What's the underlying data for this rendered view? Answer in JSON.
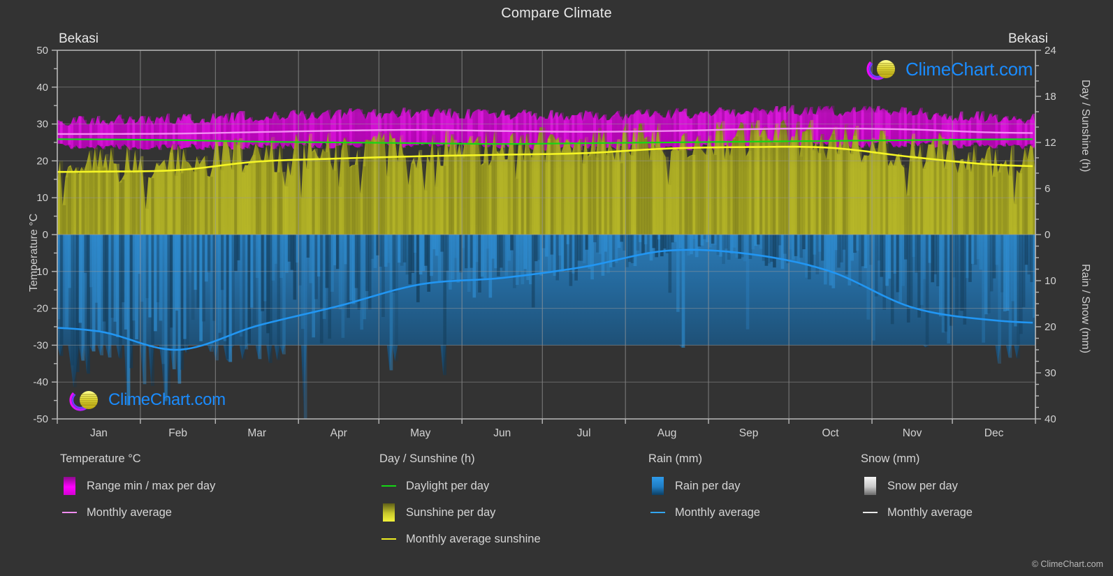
{
  "header": {
    "title": "Compare Climate",
    "location_left": "Bekasi",
    "location_right": "Bekasi"
  },
  "axes": {
    "left_title": "Temperature °C",
    "right_top_title": "Day / Sunshine (h)",
    "right_bottom_title": "Rain / Snow (mm)",
    "left_ticks": [
      "50",
      "40",
      "30",
      "20",
      "10",
      "0",
      "-10",
      "-20",
      "-30",
      "-40",
      "-50"
    ],
    "right_top_ticks": [
      "24",
      "18",
      "12",
      "6",
      "0"
    ],
    "right_bottom_ticks": [
      "0",
      "10",
      "20",
      "30",
      "40"
    ],
    "x_ticks": [
      "Jan",
      "Feb",
      "Mar",
      "Apr",
      "May",
      "Jun",
      "Jul",
      "Aug",
      "Sep",
      "Oct",
      "Nov",
      "Dec"
    ]
  },
  "legend": {
    "groups": [
      {
        "heading": "Temperature °C",
        "items": [
          {
            "label": "Range min / max per day",
            "key": "swatch",
            "color": "#ee00ee"
          },
          {
            "label": "Monthly average",
            "key": "line",
            "color": "#f18df1"
          }
        ]
      },
      {
        "heading": "Day / Sunshine (h)",
        "items": [
          {
            "label": "Daylight per day",
            "key": "line",
            "color": "#14d814"
          },
          {
            "label": "Sunshine per day",
            "key": "swatch",
            "color": "#f2f23a"
          },
          {
            "label": "Monthly average sunshine",
            "key": "line",
            "color": "#eeee22"
          }
        ]
      },
      {
        "heading": "Rain (mm)",
        "items": [
          {
            "label": "Rain per day",
            "key": "swatch",
            "color": "#1f8fe0"
          },
          {
            "label": "Monthly average",
            "key": "line",
            "color": "#33a6f0"
          }
        ]
      },
      {
        "heading": "Snow (mm)",
        "items": [
          {
            "label": "Snow per day",
            "key": "swatch",
            "color": "#e8e8e8"
          },
          {
            "label": "Monthly average",
            "key": "line",
            "color": "#eaeaea"
          }
        ]
      }
    ]
  },
  "footer": {
    "copyright": "© ClimeChart.com"
  },
  "watermark": {
    "text": "ClimeChart.com"
  },
  "colors": {
    "background": "#333333",
    "grid": "#8d8d8d",
    "temp_band": "#cc00cc",
    "temp_avg_line": "#f18df1",
    "daylight_line": "#14d814",
    "sunshine_band": "#a8a821",
    "sunshine_avg_line": "#f5f525",
    "rain_band": "#1f6fa8",
    "rain_avg_line": "#2196f3",
    "logo_blue": "#1a8cff",
    "logo_magenta": "#dd00dd"
  },
  "chart_data": {
    "type": "area",
    "title": "Compare Climate",
    "subtitle": "Bekasi",
    "xlabel": "",
    "ylabel": "Temperature °C",
    "categories": [
      "Jan",
      "Feb",
      "Mar",
      "Apr",
      "May",
      "Jun",
      "Jul",
      "Aug",
      "Sep",
      "Oct",
      "Nov",
      "Dec"
    ],
    "axis_ranges": {
      "temperature_c": [
        -50,
        50
      ],
      "day_sunshine_h": [
        0,
        24
      ],
      "rain_snow_mm": [
        0,
        40
      ]
    },
    "grid": true,
    "legend_position": "below",
    "series": [
      {
        "name": "Monthly average temperature",
        "unit": "°C",
        "axis": "temperature_c",
        "color": "#f18df1",
        "values": [
          27.3,
          27.4,
          27.8,
          28.2,
          28.4,
          28.1,
          27.9,
          28.1,
          28.6,
          28.8,
          28.5,
          27.7
        ]
      },
      {
        "name": "Range max per day",
        "unit": "°C",
        "axis": "temperature_c",
        "color": "#cc00cc",
        "values": [
          31.0,
          31.2,
          32.0,
          32.6,
          32.7,
          32.3,
          32.1,
          32.5,
          33.2,
          33.4,
          32.8,
          31.6
        ]
      },
      {
        "name": "Range min per day",
        "unit": "°C",
        "axis": "temperature_c",
        "color": "#cc00cc",
        "values": [
          23.8,
          23.8,
          24.0,
          24.3,
          24.4,
          23.9,
          23.5,
          23.6,
          23.9,
          24.3,
          24.4,
          24.1
        ]
      },
      {
        "name": "Daylight per day",
        "unit": "h",
        "axis": "day_sunshine_h",
        "color": "#14d814",
        "values": [
          12.4,
          12.3,
          12.1,
          12.0,
          11.9,
          11.8,
          11.9,
          12.0,
          12.1,
          12.2,
          12.3,
          12.4
        ]
      },
      {
        "name": "Monthly average sunshine",
        "unit": "h",
        "axis": "day_sunshine_h",
        "color": "#f5f525",
        "values": [
          8.2,
          8.4,
          9.5,
          9.9,
          10.2,
          10.4,
          10.6,
          11.2,
          11.4,
          11.3,
          10.1,
          9.1
        ]
      },
      {
        "name": "Monthly average rain",
        "unit": "mm",
        "axis": "rain_snow_mm",
        "color": "#2196f3",
        "values": [
          21.0,
          25.0,
          19.8,
          15.5,
          10.8,
          9.4,
          7.0,
          3.5,
          4.2,
          8.0,
          15.8,
          18.6
        ]
      },
      {
        "name": "Monthly average snow",
        "unit": "mm",
        "axis": "rain_snow_mm",
        "color": "#eaeaea",
        "values": [
          0,
          0,
          0,
          0,
          0,
          0,
          0,
          0,
          0,
          0,
          0,
          0
        ]
      }
    ]
  }
}
